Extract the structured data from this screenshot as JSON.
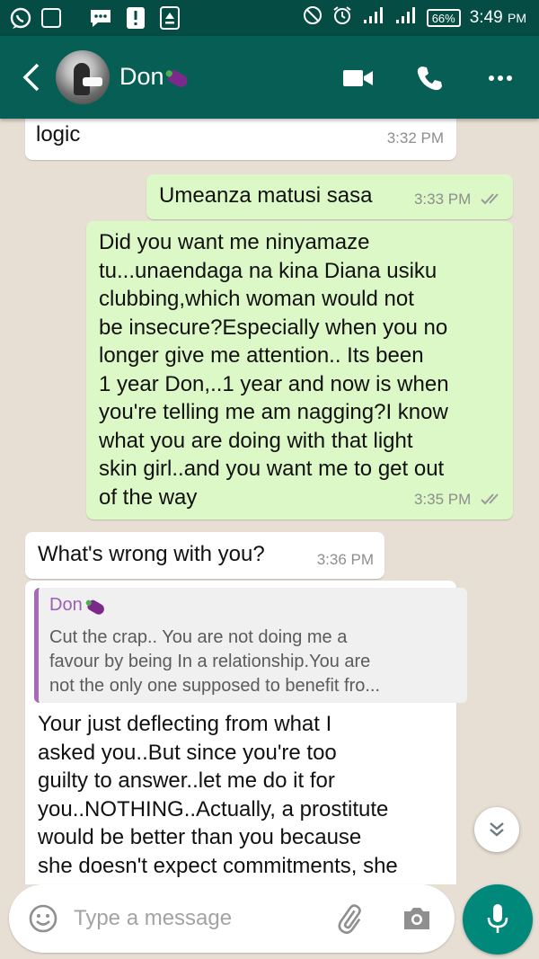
{
  "status_bar": {
    "battery": "66%",
    "time": "3:49",
    "ampm": "PM",
    "icons": [
      "whatsapp-icon",
      "gallery-icon",
      "messages-icon",
      "alert-icon",
      "upload-icon",
      "do-not-disturb-icon",
      "alarm-icon",
      "signal-icon",
      "signal-icon",
      "battery-icon"
    ]
  },
  "header": {
    "contact_name": "Don",
    "contact_emoji": "eggplant-emoji",
    "icons": [
      "back-arrow-icon",
      "video-call-icon",
      "phone-call-icon",
      "more-options-icon"
    ],
    "colors": {
      "bar": "#075e54",
      "status_bar": "#054d44"
    }
  },
  "messages": [
    {
      "direction": "incoming",
      "text": "logic",
      "time": "3:32 PM"
    },
    {
      "direction": "outgoing",
      "text": "Umeanza matusi sasa",
      "time": "3:33 PM",
      "ticks": "read"
    },
    {
      "direction": "outgoing",
      "lines": [
        "Did you want me ninyamaze",
        "tu...unaendaga na kina Diana usiku",
        "clubbing,which woman would not",
        "be insecure?Especially when you no",
        "longer give me attention.. Its been",
        "1 year Don,..1 year and now is when",
        "you're telling me am nagging?I know",
        "what you are doing with that light",
        "skin girl..and you want me to get out",
        "of the way"
      ],
      "time": "3:35 PM",
      "ticks": "read"
    },
    {
      "direction": "incoming",
      "text": "What's wrong with you?",
      "time": "3:36 PM"
    },
    {
      "direction": "incoming",
      "quote": {
        "author": "Don",
        "lines": [
          "Cut the crap.. You are not doing me a",
          "favour by being In a relationship.You are",
          "not the only one supposed to benefit fro..."
        ]
      },
      "lines": [
        "Your just deflecting from what I",
        "asked you..But since you're too",
        "guilty to answer..let me do it for",
        "you..NOTHING..Actually, a prostitute",
        "would be better than you because",
        "she doesn't expect commitments, she"
      ]
    }
  ],
  "input_bar": {
    "placeholder": "Type a message",
    "icons": [
      "emoji-icon",
      "attach-icon",
      "camera-icon",
      "mic-icon",
      "scroll-down-icon"
    ]
  },
  "colors": {
    "incoming_bubble": "#ffffff",
    "outgoing_bubble": "#dcf8c6",
    "chat_background": "#e7dfd4",
    "accent": "#00897b"
  }
}
